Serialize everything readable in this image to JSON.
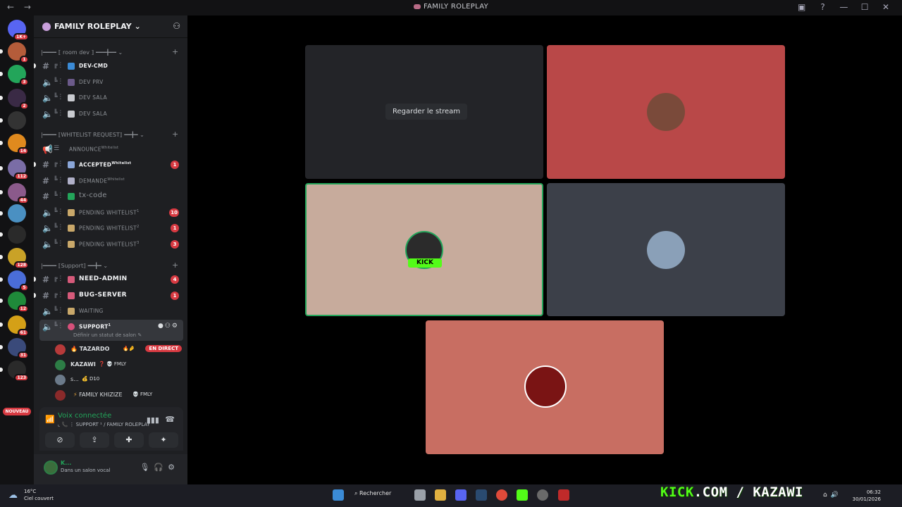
{
  "window": {
    "title": "FAMILY ROLEPLAY",
    "nav_back": "←",
    "nav_forward": "→"
  },
  "rail": {
    "servers": [
      {
        "badge": "1K+",
        "color": "#5865f2"
      },
      {
        "badge": "1",
        "color": "#b45c3a"
      },
      {
        "badge": "3",
        "color": "#23a55a"
      },
      {
        "badge": "2",
        "color": "#3a2a45"
      },
      {
        "badge": "",
        "color": "#333333"
      },
      {
        "badge": "14",
        "color": "#e08a1e"
      },
      {
        "badge": "112",
        "color": "#7a6da6"
      },
      {
        "badge": "44",
        "color": "#8b5a8b"
      },
      {
        "badge": "",
        "color": "#4a90c2"
      },
      {
        "badge": "",
        "color": "#2a2a2a"
      },
      {
        "badge": "128",
        "color": "#c9a227"
      },
      {
        "badge": "5",
        "color": "#4a6dd8"
      },
      {
        "badge": "12",
        "color": "#1f8a3a"
      },
      {
        "badge": "61",
        "color": "#d4a017"
      },
      {
        "badge": "31",
        "color": "#3a4a7a"
      },
      {
        "badge": "123",
        "color": "#2a2a2a"
      }
    ],
    "new_label": "NOUVEAU"
  },
  "server": {
    "name": "FAMILY ROLEPLAY",
    "chevron": "⌄"
  },
  "categories": [
    {
      "label": "|━━━━ ⟦ room dev ⟧ ━━━╋━━ ⌄"
    },
    {
      "label": "|━━━━ ⟦WHITELIST REQUEST⟧ ━━╋━ ⌄"
    },
    {
      "label": "|━━━━ ⟦Support⟧ ━━╋━ ⌄"
    }
  ],
  "channels": {
    "dev_cmd": "DEV-CMD",
    "dev_prv": "DEV PRV",
    "dev_sala1": "DEV SALA",
    "dev_sala2": "DEV SALA",
    "announce": "ANNOUNCE",
    "announce_sup": "Whitelist",
    "accepted": "ACCEPTED",
    "accepted_sup": "Whitelist",
    "accepted_count": "1",
    "demande": "DEMANDE",
    "demande_sup": "Whitelist",
    "tx_code": "tx-code",
    "pending1": "PENDING WHITELIST",
    "pending1_sup": "1",
    "pending1_count": "10",
    "pending2": "PENDING WHITELIST",
    "pending2_sup": "2",
    "pending2_count": "1",
    "pending3": "PENDING WHITELIST",
    "pending3_sup": "3",
    "pending3_count": "3",
    "need_admin": "NEED-ADMIN",
    "need_admin_count": "4",
    "bug_server": "BUG-SERVER",
    "bug_server_count": "1",
    "waiting": "WAITING",
    "support": "SUPPORT",
    "support_sup": "1",
    "support_status": "Définir un statut de salon ✎"
  },
  "voice_users": [
    {
      "name": "TAZARDO",
      "tag": "🔥🤌",
      "live": "EN DIRECT",
      "color": "#b73a3a"
    },
    {
      "name": "KAZAWI",
      "tag": "❓ 💀 FMLY",
      "color": "#2d7d46"
    },
    {
      "name": "s...",
      "tag": "💰 D10",
      "color": "#6b7a8a"
    },
    {
      "name": "FAMILY KHIZIZE",
      "tag": "💀 FMLY",
      "color": "#8a2a2a"
    }
  ],
  "voice": {
    "connected": "Voix connectée",
    "channel_path": "⌞ 📞 ⋮ SUPPORT ¹ / FAMILY ROLEPLAY"
  },
  "user": {
    "name": "K...",
    "status": "Dans un salon vocal"
  },
  "stage": {
    "watch_stream": "Regarder le stream",
    "tiles": [
      {
        "bg": "#232428",
        "type": "stream"
      },
      {
        "bg": "#b94848",
        "avatar": "#7a4a3a"
      },
      {
        "bg": "#c7ab9c",
        "avatar": "#2b2b2b",
        "speaking": true,
        "kick": "KICK"
      },
      {
        "bg": "#3c4049",
        "avatar": "#8aa0b8"
      },
      {
        "bg": "#c86e62",
        "avatar": "#7a1414"
      }
    ]
  },
  "taskbar": {
    "temp": "16°C",
    "weather": "Ciel couvert",
    "search": "Rechercher",
    "time": "06:32",
    "date": "30/01/2026"
  },
  "brand": {
    "kick": "KICK",
    "rest": ".COM / KAZAWI"
  }
}
